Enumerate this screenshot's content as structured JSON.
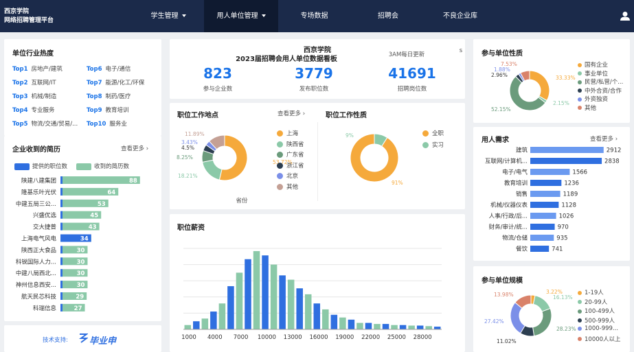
{
  "header": {
    "school_name": "西京学院",
    "platform_name": "网络招聘管理平台",
    "nav": [
      "学生管理",
      "用人单位管理",
      "专场数据",
      "招聘会",
      "不良企业库"
    ]
  },
  "industry_heat": {
    "title": "单位行业热度",
    "items": [
      {
        "rank": "Top1",
        "name": "房地产/建筑"
      },
      {
        "rank": "Top2",
        "name": "互联网/IT"
      },
      {
        "rank": "Top3",
        "name": "机械/制造"
      },
      {
        "rank": "Top4",
        "name": "专业服务"
      },
      {
        "rank": "Top5",
        "name": "物流/交通/贸易/..."
      },
      {
        "rank": "Top6",
        "name": "电子/通信"
      },
      {
        "rank": "Top7",
        "name": "能源/化工/环保"
      },
      {
        "rank": "Top8",
        "name": "制药/医疗"
      },
      {
        "rank": "Top9",
        "name": "教育培训"
      },
      {
        "rank": "Top10",
        "name": "服务业"
      }
    ]
  },
  "resumes": {
    "title": "企业收到的简历",
    "more": "查看更多",
    "legend": [
      "提供的职位数",
      "收到的简历数"
    ],
    "chart_data": {
      "type": "bar",
      "categories": [
        "陕建八建集团",
        "隆基乐叶光伏",
        "中建五局三公...",
        "兴盛优选",
        "交大捷普",
        "上海电气风电",
        "陕西正大食品",
        "科锐国际人力...",
        "中建八局西北...",
        "神州信息西安...",
        "航天民芯科技",
        "科瑞信息"
      ],
      "series": [
        {
          "name": "提供的职位数",
          "values": [
            1,
            1,
            1,
            1,
            1,
            34,
            1,
            1,
            1,
            1,
            1,
            1
          ]
        },
        {
          "name": "收到的简历数",
          "values": [
            88,
            64,
            53,
            45,
            43,
            34,
            30,
            30,
            30,
            30,
            29,
            27
          ]
        }
      ],
      "xlim": [
        0,
        95
      ]
    }
  },
  "footer": {
    "tech_support": "技术支持:",
    "logo_text": "毕业申"
  },
  "stats": {
    "school": "西京学院",
    "title": "2023届招聘会用人单位数据看板",
    "update": "3AM每日更新",
    "edge": "s",
    "items": [
      {
        "value": "823",
        "label": "参与企业数"
      },
      {
        "value": "3779",
        "label": "发布职位数"
      },
      {
        "value": "41691",
        "label": "招聘岗位数"
      }
    ]
  },
  "location": {
    "title": "职位工作地点",
    "more": "查看更多",
    "caption": "省份",
    "chart_data": {
      "type": "pie",
      "labels": [
        "上海",
        "陕西省",
        "广东省",
        "浙江省",
        "北京",
        "其他"
      ],
      "values": [
        53.72,
        18.21,
        8.25,
        4.5,
        3.43,
        11.89
      ],
      "colors": [
        "#f5a93b",
        "#8bc9a8",
        "#6b9b7c",
        "#2c3e50",
        "#7b8fe8",
        "#c4a095"
      ],
      "pct_text": [
        "53.72%",
        "18.21%",
        "8.25%",
        "4.5%",
        "3.43%",
        "11.89%"
      ]
    }
  },
  "nature": {
    "title": "职位工作性质",
    "chart_data": {
      "type": "pie",
      "labels": [
        "全职",
        "实习"
      ],
      "values": [
        91,
        9
      ],
      "colors": [
        "#f5a93b",
        "#8bc9a8"
      ],
      "pct_text": [
        "91%",
        "9%"
      ]
    }
  },
  "salary": {
    "title": "职位薪资",
    "chart_data": {
      "type": "bar",
      "x_ticks": [
        "1000",
        "4000",
        "7000",
        "10000",
        "13000",
        "16000",
        "19000",
        "22000",
        "25000",
        "28000"
      ],
      "values": [
        8,
        15,
        20,
        33,
        48,
        80,
        105,
        130,
        145,
        137,
        120,
        100,
        92,
        76,
        65,
        48,
        37,
        27,
        22,
        18,
        12,
        12,
        10,
        10,
        8,
        8,
        7,
        7,
        6,
        5
      ],
      "ylim": [
        0,
        150
      ]
    }
  },
  "unit_nature": {
    "title": "参与单位性质",
    "chart_data": {
      "type": "pie",
      "labels": [
        "国有企业",
        "事业单位",
        "民营/私营/个...",
        "中外合资/合作",
        "外资独资",
        "其他"
      ],
      "values": [
        33.33,
        2.15,
        52.15,
        2.96,
        1.88,
        7.53
      ],
      "colors": [
        "#f5a93b",
        "#8bc9a8",
        "#6b9b7c",
        "#2c3e50",
        "#7b8fe8",
        "#d9826a"
      ],
      "pct_text": [
        "33.33%",
        "2.15%",
        "52.15%",
        "2.96%",
        "1.88%",
        "7.53%"
      ]
    }
  },
  "demand": {
    "title": "用人需求",
    "more": "查看更多",
    "chart_data": {
      "type": "bar",
      "categories": [
        "建筑",
        "互联网/计算机...",
        "电子/电气",
        "教育培训",
        "销售",
        "机械/仪器仪表",
        "人事/行政/后...",
        "财务/审计/统...",
        "物流/仓储",
        "餐饮"
      ],
      "values": [
        2912,
        2838,
        1566,
        1236,
        1189,
        1128,
        1026,
        970,
        935,
        741
      ],
      "xlim": [
        0,
        3000
      ],
      "colors": [
        "#6b9af0",
        "#2f6fe0",
        "#6b9af0",
        "#2f6fe0",
        "#6b9af0",
        "#2f6fe0",
        "#6b9af0",
        "#2f6fe0",
        "#6b9af0",
        "#2f6fe0"
      ]
    }
  },
  "scale": {
    "title": "参与单位规模",
    "chart_data": {
      "type": "pie",
      "labels": [
        "1-19人",
        "20-99人",
        "100-499人",
        "500-999人",
        "1000-999...",
        "10000人以上"
      ],
      "values": [
        3.22,
        16.13,
        28.23,
        11.02,
        27.42,
        13.98
      ],
      "colors": [
        "#f5a93b",
        "#8bc9a8",
        "#6b9b7c",
        "#2c3e50",
        "#7b8fe8",
        "#d9826a"
      ],
      "pct_text": [
        "3.22%",
        "16.13%",
        "28.23%",
        "11.02%",
        "27.42%",
        "13.98%"
      ]
    }
  }
}
